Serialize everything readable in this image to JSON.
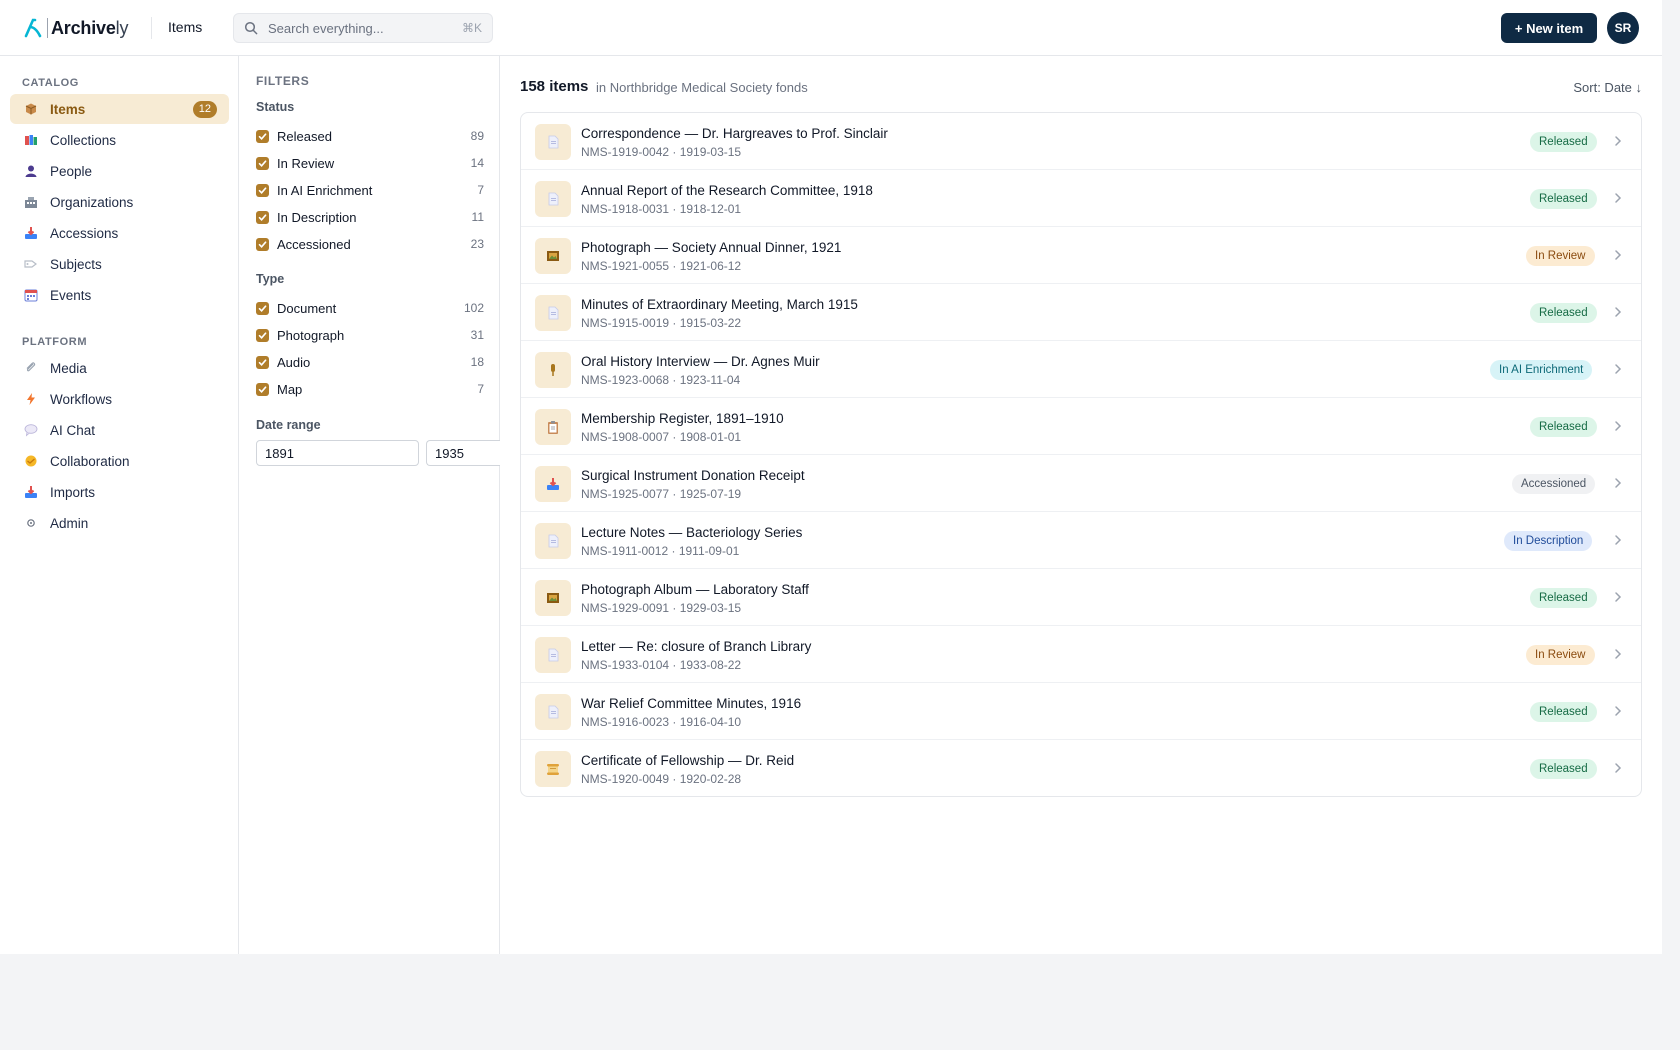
{
  "header": {
    "logo_strong": "Archive",
    "logo_light": "ly",
    "crumb": "Items",
    "search_placeholder": "Search everything...",
    "search_kbd": "⌘K",
    "new_button": "+ New item",
    "avatar_initials": "SR"
  },
  "sidebar": {
    "catalog_label": "CATALOG",
    "platform_label": "PLATFORM",
    "catalog": [
      {
        "label": "Items",
        "icon": "box-icon",
        "badge": "12",
        "active": true
      },
      {
        "label": "Collections",
        "icon": "books-icon"
      },
      {
        "label": "People",
        "icon": "person-icon"
      },
      {
        "label": "Organizations",
        "icon": "building-icon"
      },
      {
        "label": "Accessions",
        "icon": "inbox-tray-icon"
      },
      {
        "label": "Subjects",
        "icon": "tag-icon"
      },
      {
        "label": "Events",
        "icon": "calendar-icon"
      }
    ],
    "platform": [
      {
        "label": "Media",
        "icon": "paperclip-icon"
      },
      {
        "label": "Workflows",
        "icon": "lightning-icon"
      },
      {
        "label": "AI Chat",
        "icon": "speech-bubble-icon"
      },
      {
        "label": "Collaboration",
        "icon": "handshake-icon"
      },
      {
        "label": "Imports",
        "icon": "inbox-tray-icon"
      },
      {
        "label": "Admin",
        "icon": "gear-icon"
      }
    ]
  },
  "filters": {
    "title": "FILTERS",
    "status_label": "Status",
    "status": [
      {
        "label": "Released",
        "count": "89"
      },
      {
        "label": "In Review",
        "count": "14"
      },
      {
        "label": "In AI Enrichment",
        "count": "7"
      },
      {
        "label": "In Description",
        "count": "11"
      },
      {
        "label": "Accessioned",
        "count": "23"
      }
    ],
    "type_label": "Type",
    "type": [
      {
        "label": "Document",
        "count": "102"
      },
      {
        "label": "Photograph",
        "count": "31"
      },
      {
        "label": "Audio",
        "count": "18"
      },
      {
        "label": "Map",
        "count": "7"
      }
    ],
    "date_label": "Date range",
    "date_from": "1891",
    "date_to": "1935"
  },
  "main": {
    "count": "158 items",
    "context": "in Northbridge Medical Society fonds",
    "sort": "Sort: Date ↓",
    "items": [
      {
        "title": "Correspondence — Dr. Hargreaves to Prof. Sinclair",
        "meta": "NMS-1919-0042 · 1919-03-15",
        "status": "Released",
        "kind": "released",
        "icon": "document-icon"
      },
      {
        "title": "Annual Report of the Research Committee, 1918",
        "meta": "NMS-1918-0031 · 1918-12-01",
        "status": "Released",
        "kind": "released",
        "icon": "document-icon"
      },
      {
        "title": "Photograph — Society Annual Dinner, 1921",
        "meta": "NMS-1921-0055 · 1921-06-12",
        "status": "In Review",
        "kind": "review",
        "icon": "framed-picture-icon"
      },
      {
        "title": "Minutes of Extraordinary Meeting, March 1915",
        "meta": "NMS-1915-0019 · 1915-03-22",
        "status": "Released",
        "kind": "released",
        "icon": "document-icon"
      },
      {
        "title": "Oral History Interview — Dr. Agnes Muir",
        "meta": "NMS-1923-0068 · 1923-11-04",
        "status": "In AI Enrichment",
        "kind": "ai",
        "icon": "microphone-icon"
      },
      {
        "title": "Membership Register, 1891–1910",
        "meta": "NMS-1908-0007 · 1908-01-01",
        "status": "Released",
        "kind": "released",
        "icon": "clipboard-icon"
      },
      {
        "title": "Surgical Instrument Donation Receipt",
        "meta": "NMS-1925-0077 · 1925-07-19",
        "status": "Accessioned",
        "kind": "accessioned",
        "icon": "inbox-tray-icon"
      },
      {
        "title": "Lecture Notes — Bacteriology Series",
        "meta": "NMS-1911-0012 · 1911-09-01",
        "status": "In Description",
        "kind": "description",
        "icon": "document-icon"
      },
      {
        "title": "Photograph Album — Laboratory Staff",
        "meta": "NMS-1929-0091 · 1929-03-15",
        "status": "Released",
        "kind": "released",
        "icon": "framed-picture-icon"
      },
      {
        "title": "Letter — Re: closure of Branch Library",
        "meta": "NMS-1933-0104 · 1933-08-22",
        "status": "In Review",
        "kind": "review",
        "icon": "document-icon"
      },
      {
        "title": "War Relief Committee Minutes, 1916",
        "meta": "NMS-1916-0023 · 1916-04-10",
        "status": "Released",
        "kind": "released",
        "icon": "document-icon"
      },
      {
        "title": "Certificate of Fellowship — Dr. Reid",
        "meta": "NMS-1920-0049 · 1920-02-28",
        "status": "Released",
        "kind": "released",
        "icon": "scroll-icon"
      }
    ]
  }
}
